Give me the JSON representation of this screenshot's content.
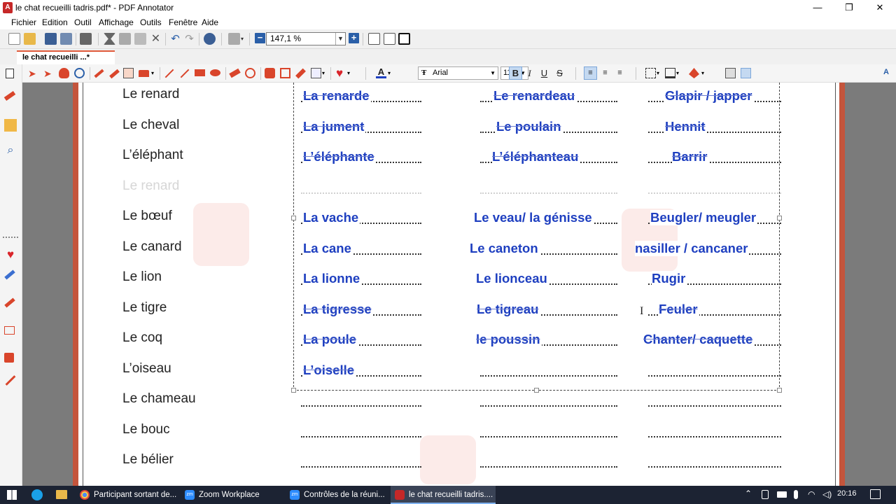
{
  "window": {
    "title": "le chat recueilli tadris.pdf* - PDF Annotator",
    "controls": [
      "—",
      "❐",
      "✕"
    ]
  },
  "menu": [
    "Fichier",
    "Edition",
    "Outil",
    "Affichage",
    "Outils",
    "Fenêtre",
    "Aide"
  ],
  "toolbar": {
    "zoom_value": "147,1 %",
    "zoom_out_label": "−",
    "zoom_in_label": "+"
  },
  "tab": {
    "label": "le chat recueilli ...*"
  },
  "annotation_toolbar": {
    "font_name": "Arial",
    "font_size": "11",
    "format_buttons": [
      "B",
      "I",
      "U",
      "S"
    ],
    "text_color": "#1e3fc0"
  },
  "worksheet": {
    "rows": [
      {
        "animal": "Le renard",
        "female": "La renarde",
        "young": "Le renardeau",
        "cry": "Glapir / japper",
        "struck": true
      },
      {
        "animal": "Le cheval",
        "female": "La jument",
        "young": "Le poulain",
        "cry": "Hennit",
        "struck": true
      },
      {
        "animal": "L’éléphant",
        "female": "L’éléphante",
        "young": "L’éléphanteau",
        "cry": "Barrir",
        "struck": true
      },
      {
        "animal": "Le renard",
        "female": "",
        "young": "",
        "cry": "",
        "faded": true
      },
      {
        "animal": "Le bœuf",
        "female": "La vache",
        "young": "Le veau/ la génisse",
        "cry": "Beugler/ meugler",
        "struck": false
      },
      {
        "animal": "Le canard",
        "female": "La cane",
        "young": "Le caneton",
        "cry": "nasiller / cancaner",
        "struck": false
      },
      {
        "animal": "Le lion",
        "female": "La lionne",
        "young": "Le lionceau",
        "cry": "Rugir",
        "struck": false
      },
      {
        "animal": "Le tigre",
        "female": "La tigresse",
        "young": "Le tigreau",
        "cry": "Feuler",
        "struck": true
      },
      {
        "animal": "Le coq",
        "female": "La poule",
        "young": "le poussin",
        "cry": "Chanter/ caquette",
        "struck": true
      },
      {
        "animal": "L’oiseau",
        "female": "L’oiselle",
        "young": "",
        "cry": "",
        "struck": true
      },
      {
        "animal": "Le chameau",
        "female": "",
        "young": "",
        "cry": ""
      },
      {
        "animal": "Le bouc",
        "female": "",
        "young": "",
        "cry": ""
      },
      {
        "animal": "Le bélier",
        "female": "",
        "young": "",
        "cry": ""
      }
    ]
  },
  "taskbar": {
    "items": [
      {
        "label": "Participant sortant de...",
        "icon": "chrome-icon"
      },
      {
        "label": "Zoom Workplace",
        "icon": "zoom-icon"
      },
      {
        "label": "Contrôles de la réuni...",
        "icon": "zoom-icon"
      },
      {
        "label": "le chat recueilli tadris....",
        "icon": "pdf-annotator-icon"
      }
    ],
    "clock": "20:16"
  }
}
